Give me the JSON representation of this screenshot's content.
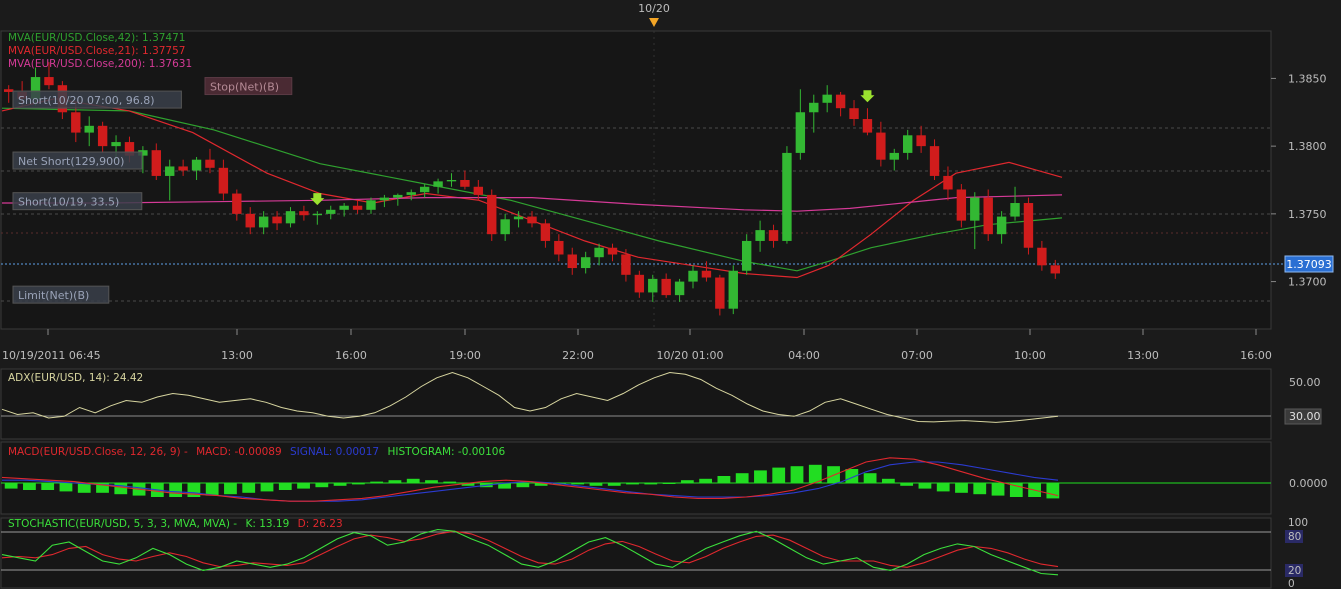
{
  "top_marker": {
    "label": "10/20"
  },
  "main": {
    "legend": [
      {
        "text": "MVA(EUR/USD.Close,42): 1.37471",
        "color": "#2fa12f"
      },
      {
        "text": "MVA(EUR/USD.Close,21): 1.37757",
        "color": "#e0282e"
      },
      {
        "text": "MVA(EUR/USD.Close,200): 1.37631",
        "color": "#d53a97"
      }
    ],
    "order_labels": [
      {
        "text": "Short(10/20 07:00, 96.8)",
        "price": 1.3834
      },
      {
        "text": "Net Short(129,900)",
        "price": 1.3789
      },
      {
        "text": "Short(10/19, 33.5)",
        "price": 1.3759
      },
      {
        "text": "Limit(Net)(B)",
        "price": 1.369
      }
    ],
    "stop_label": {
      "text": "Stop(Net)(B)",
      "price": 1.3844
    },
    "price_ticks": [
      "1.3850",
      "1.3800",
      "1.3750",
      "1.3700"
    ],
    "current_price": "1.37093",
    "time_ticks": [
      "10/19/2011 06:45",
      "13:00",
      "16:00",
      "19:00",
      "22:00",
      "10/20 01:00",
      "04:00",
      "07:00",
      "10:00",
      "13:00",
      "16:00"
    ]
  },
  "adx_panel": {
    "label": "ADX(EUR/USD, 14): 24.42",
    "ticks": [
      "50.00",
      "30.00"
    ]
  },
  "macd_panel": {
    "title": "MACD(EUR/USD.Close, 12, 26, 9) -",
    "macd_text": "MACD: -0.00089",
    "signal_text": "SIGNAL: 0.00017",
    "hist_text": "HISTOGRAM: -0.00106",
    "ticks": [
      "0.0000"
    ]
  },
  "stoch_panel": {
    "label": "STOCHASTIC(EUR/USD, 5, 3, 3, MVA, MVA) -",
    "k_text": "K: 13.19",
    "d_text": "D: 26.23",
    "ticks": [
      "100",
      "80",
      "20",
      "0"
    ]
  },
  "chart_data": {
    "type": "candlestick",
    "instrument": "EUR/USD",
    "ylim": [
      1.3665,
      1.3885
    ],
    "time_range": [
      "10/19/2011 06:45",
      "10/20 ~11:00"
    ],
    "candles_ohlc": [
      [
        1.3842,
        1.3845,
        1.3832,
        1.384
      ],
      [
        1.384,
        1.3848,
        1.383,
        1.3835
      ],
      [
        1.3835,
        1.3858,
        1.383,
        1.3851
      ],
      [
        1.3851,
        1.3862,
        1.3842,
        1.3845
      ],
      [
        1.3845,
        1.3848,
        1.382,
        1.3825
      ],
      [
        1.3825,
        1.3832,
        1.3803,
        1.381
      ],
      [
        1.381,
        1.3822,
        1.38,
        1.3815
      ],
      [
        1.3815,
        1.3818,
        1.3795,
        1.38
      ],
      [
        1.38,
        1.3808,
        1.379,
        1.3803
      ],
      [
        1.3803,
        1.3807,
        1.3788,
        1.3793
      ],
      [
        1.3793,
        1.38,
        1.378,
        1.3797
      ],
      [
        1.3797,
        1.3802,
        1.3775,
        1.3778
      ],
      [
        1.3778,
        1.379,
        1.376,
        1.3785
      ],
      [
        1.3785,
        1.379,
        1.3778,
        1.3782
      ],
      [
        1.3782,
        1.3792,
        1.3775,
        1.379
      ],
      [
        1.379,
        1.3798,
        1.378,
        1.3784
      ],
      [
        1.3784,
        1.379,
        1.376,
        1.3765
      ],
      [
        1.3765,
        1.3768,
        1.3745,
        1.375
      ],
      [
        1.375,
        1.3755,
        1.3735,
        1.374
      ],
      [
        1.374,
        1.3752,
        1.3735,
        1.3748
      ],
      [
        1.3748,
        1.3752,
        1.3738,
        1.3743
      ],
      [
        1.3743,
        1.3755,
        1.374,
        1.3752
      ],
      [
        1.3752,
        1.3756,
        1.3745,
        1.3749
      ],
      [
        1.3749,
        1.3752,
        1.3742,
        1.375
      ],
      [
        1.375,
        1.3756,
        1.3746,
        1.3753
      ],
      [
        1.3753,
        1.3758,
        1.3748,
        1.3756
      ],
      [
        1.3756,
        1.376,
        1.375,
        1.3753
      ],
      [
        1.3753,
        1.3762,
        1.375,
        1.376
      ],
      [
        1.376,
        1.3764,
        1.3755,
        1.3762
      ],
      [
        1.3762,
        1.3765,
        1.3756,
        1.3764
      ],
      [
        1.3764,
        1.3768,
        1.376,
        1.3766
      ],
      [
        1.3766,
        1.3772,
        1.3762,
        1.377
      ],
      [
        1.377,
        1.3776,
        1.3765,
        1.3774
      ],
      [
        1.3774,
        1.378,
        1.377,
        1.3775
      ],
      [
        1.3775,
        1.3782,
        1.3768,
        1.377
      ],
      [
        1.377,
        1.3775,
        1.376,
        1.3764
      ],
      [
        1.3764,
        1.3768,
        1.373,
        1.3735
      ],
      [
        1.3735,
        1.375,
        1.373,
        1.3746
      ],
      [
        1.3746,
        1.3752,
        1.374,
        1.3748
      ],
      [
        1.3748,
        1.3752,
        1.374,
        1.3743
      ],
      [
        1.3743,
        1.3746,
        1.3725,
        1.373
      ],
      [
        1.373,
        1.3735,
        1.3715,
        1.372
      ],
      [
        1.372,
        1.3725,
        1.3705,
        1.371
      ],
      [
        1.371,
        1.3722,
        1.3706,
        1.3718
      ],
      [
        1.3718,
        1.3728,
        1.3712,
        1.3725
      ],
      [
        1.3725,
        1.3728,
        1.3715,
        1.372
      ],
      [
        1.372,
        1.3724,
        1.37,
        1.3705
      ],
      [
        1.3705,
        1.3708,
        1.3688,
        1.3692
      ],
      [
        1.3692,
        1.3705,
        1.3685,
        1.3702
      ],
      [
        1.3702,
        1.3706,
        1.3688,
        1.369
      ],
      [
        1.369,
        1.3702,
        1.3685,
        1.37
      ],
      [
        1.37,
        1.3712,
        1.3695,
        1.3708
      ],
      [
        1.3708,
        1.3715,
        1.37,
        1.3703
      ],
      [
        1.3703,
        1.3705,
        1.3675,
        1.368
      ],
      [
        1.368,
        1.3712,
        1.3676,
        1.3708
      ],
      [
        1.3708,
        1.3735,
        1.3705,
        1.373
      ],
      [
        1.373,
        1.3745,
        1.3722,
        1.3738
      ],
      [
        1.3738,
        1.3742,
        1.3725,
        1.373
      ],
      [
        1.373,
        1.38,
        1.3728,
        1.3795
      ],
      [
        1.3795,
        1.3842,
        1.379,
        1.3825
      ],
      [
        1.3825,
        1.3838,
        1.381,
        1.3832
      ],
      [
        1.3832,
        1.3845,
        1.3825,
        1.3838
      ],
      [
        1.3838,
        1.384,
        1.3822,
        1.3828
      ],
      [
        1.3828,
        1.3834,
        1.3815,
        1.382
      ],
      [
        1.382,
        1.3828,
        1.3808,
        1.381
      ],
      [
        1.381,
        1.3818,
        1.3785,
        1.379
      ],
      [
        1.379,
        1.3798,
        1.3782,
        1.3795
      ],
      [
        1.3795,
        1.3812,
        1.379,
        1.3808
      ],
      [
        1.3808,
        1.3815,
        1.3795,
        1.38
      ],
      [
        1.38,
        1.3805,
        1.3775,
        1.3778
      ],
      [
        1.3778,
        1.3785,
        1.376,
        1.3768
      ],
      [
        1.3768,
        1.3772,
        1.374,
        1.3745
      ],
      [
        1.3745,
        1.3766,
        1.3724,
        1.3762
      ],
      [
        1.3762,
        1.3768,
        1.373,
        1.3735
      ],
      [
        1.3735,
        1.3752,
        1.3728,
        1.3748
      ],
      [
        1.3748,
        1.377,
        1.3745,
        1.3758
      ],
      [
        1.3758,
        1.3762,
        1.372,
        1.3725
      ],
      [
        1.3725,
        1.373,
        1.3708,
        1.3712
      ],
      [
        1.3712,
        1.3716,
        1.3702,
        1.3706
      ]
    ],
    "series": [
      {
        "name": "MVA(EUR/USD.Close,42)",
        "color": "#2fa12f",
        "x_rel": [
          0,
          0.06,
          0.12,
          0.2,
          0.3,
          0.4,
          0.48,
          0.55,
          0.62,
          0.7,
          0.75,
          0.78,
          0.82,
          0.88,
          0.93,
          1
        ],
        "y": [
          1.3828,
          1.3827,
          1.3826,
          1.3812,
          1.3787,
          1.3772,
          1.376,
          1.3745,
          1.373,
          1.3715,
          1.3708,
          1.3715,
          1.3725,
          1.3735,
          1.3742,
          1.3747
        ]
      },
      {
        "name": "MVA(EUR/USD.Close,21)",
        "color": "#e0282e",
        "x_rel": [
          0,
          0.05,
          0.12,
          0.18,
          0.25,
          0.3,
          0.35,
          0.4,
          0.45,
          0.5,
          0.55,
          0.6,
          0.65,
          0.7,
          0.75,
          0.78,
          0.82,
          0.86,
          0.9,
          0.95,
          1
        ],
        "y": [
          1.3826,
          1.3835,
          1.3826,
          1.381,
          1.378,
          1.3765,
          1.3758,
          1.3765,
          1.376,
          1.3745,
          1.373,
          1.3718,
          1.3712,
          1.3706,
          1.3703,
          1.3712,
          1.3735,
          1.376,
          1.378,
          1.3788,
          1.3777
        ]
      },
      {
        "name": "MVA(EUR/USD.Close,200)",
        "color": "#d53a97",
        "x_rel": [
          0,
          0.1,
          0.2,
          0.3,
          0.4,
          0.5,
          0.6,
          0.7,
          0.75,
          0.8,
          0.85,
          0.9,
          1
        ],
        "y": [
          1.3758,
          1.3758,
          1.3759,
          1.376,
          1.3762,
          1.3762,
          1.3757,
          1.3753,
          1.3752,
          1.3754,
          1.3758,
          1.3762,
          1.3764
        ]
      }
    ],
    "adx": {
      "ylim": [
        15,
        55
      ],
      "values": [
        32,
        29,
        30,
        27,
        28,
        33,
        30,
        34,
        37,
        36,
        39,
        41,
        40,
        38,
        36,
        37,
        38,
        36,
        33,
        31,
        30,
        28,
        27,
        28,
        30,
        34,
        39,
        45,
        50,
        53,
        50,
        45,
        40,
        33,
        31,
        33,
        38,
        41,
        39,
        37,
        41,
        46,
        50,
        53,
        52,
        49,
        44,
        40,
        35,
        31,
        29,
        28,
        31,
        36,
        38,
        35,
        32,
        29,
        27,
        25,
        24.8,
        25.2,
        25.5,
        25,
        24.5,
        25.1,
        26,
        27,
        28
      ]
    },
    "macd": {
      "ylim": [
        -0.0025,
        0.0025
      ],
      "macd_line": [
        0.0004,
        0.0003,
        0.0002,
        0.0001,
        -0.0001,
        -0.0003,
        -0.0005,
        -0.0007,
        -0.0008,
        -0.0009,
        -0.0011,
        -0.0012,
        -0.0013,
        -0.0013,
        -0.0012,
        -0.0011,
        -0.0009,
        -0.0006,
        -0.0003,
        -0.0001,
        0.0001,
        0.0002,
        0.0001,
        -0.0001,
        -0.0003,
        -0.0005,
        -0.0007,
        -0.0008,
        -0.001,
        -0.0011,
        -0.0011,
        -0.001,
        -0.0008,
        -0.0005,
        0.0001,
        0.0008,
        0.0015,
        0.0018,
        0.0017,
        0.0013,
        0.0008,
        0.0003,
        -0.0001,
        -0.0005,
        -0.0009
      ],
      "signal_line": [
        0.0002,
        0.0002,
        0.0001,
        0,
        -0.0001,
        -0.0002,
        -0.0004,
        -0.0006,
        -0.0007,
        -0.0009,
        -0.001,
        -0.0012,
        -0.0013,
        -0.0013,
        -0.0013,
        -0.0012,
        -0.001,
        -0.0008,
        -0.0006,
        -0.0004,
        -0.0002,
        0,
        0.0001,
        0,
        -0.0002,
        -0.0004,
        -0.0006,
        -0.0008,
        -0.0009,
        -0.001,
        -0.001,
        -0.001,
        -0.0009,
        -0.0007,
        -0.0004,
        0.0001,
        0.0008,
        0.0013,
        0.0015,
        0.0015,
        0.0013,
        0.001,
        0.0007,
        0.0004,
        0.0002
      ],
      "histogram": [
        -0.0004,
        -0.0005,
        -0.0005,
        -0.0006,
        -0.0007,
        -0.0007,
        -0.0008,
        -0.0009,
        -0.001,
        -0.001,
        -0.001,
        -0.0009,
        -0.0008,
        -0.0007,
        -0.0006,
        -0.0005,
        -0.0004,
        -0.0003,
        -0.0002,
        -0.0001,
        0.0001,
        0.0002,
        0.0003,
        0.0002,
        0.0001,
        -0.0002,
        -0.0003,
        -0.0004,
        -0.0003,
        -0.0002,
        -0.0001,
        -0.0001,
        -0.0002,
        -0.0002,
        -0.0001,
        -0.0001,
        0,
        0.0002,
        0.0003,
        0.0005,
        0.0007,
        0.0009,
        0.0011,
        0.0012,
        0.0013,
        0.0012,
        0.001,
        0.0007,
        0.0003,
        -0.0002,
        -0.0004,
        -0.0006,
        -0.0007,
        -0.0008,
        -0.0009,
        -0.001,
        -0.001,
        -0.0011
      ]
    },
    "stochastic": {
      "ylim": [
        0,
        100
      ],
      "k": [
        45,
        40,
        35,
        60,
        65,
        50,
        35,
        30,
        40,
        55,
        45,
        30,
        20,
        25,
        35,
        30,
        25,
        30,
        40,
        55,
        70,
        80,
        75,
        60,
        65,
        78,
        85,
        82,
        70,
        60,
        45,
        30,
        25,
        35,
        50,
        65,
        72,
        60,
        45,
        30,
        25,
        40,
        55,
        65,
        75,
        82,
        70,
        55,
        40,
        30,
        35,
        40,
        25,
        20,
        30,
        45,
        55,
        62,
        58,
        45,
        35,
        25,
        15,
        13
      ],
      "d": [
        40,
        42,
        40,
        45,
        55,
        58,
        45,
        38,
        35,
        42,
        48,
        42,
        32,
        26,
        28,
        32,
        30,
        28,
        32,
        45,
        58,
        70,
        76,
        72,
        66,
        70,
        78,
        82,
        78,
        68,
        55,
        42,
        32,
        30,
        38,
        52,
        62,
        66,
        58,
        46,
        35,
        32,
        42,
        55,
        65,
        74,
        76,
        68,
        55,
        42,
        35,
        35,
        35,
        28,
        25,
        32,
        42,
        52,
        58,
        55,
        48,
        38,
        30,
        26
      ]
    },
    "markers": [
      {
        "type": "arrow-down",
        "candle_index": 23
      },
      {
        "type": "arrow-down",
        "candle_index": 64
      }
    ]
  }
}
